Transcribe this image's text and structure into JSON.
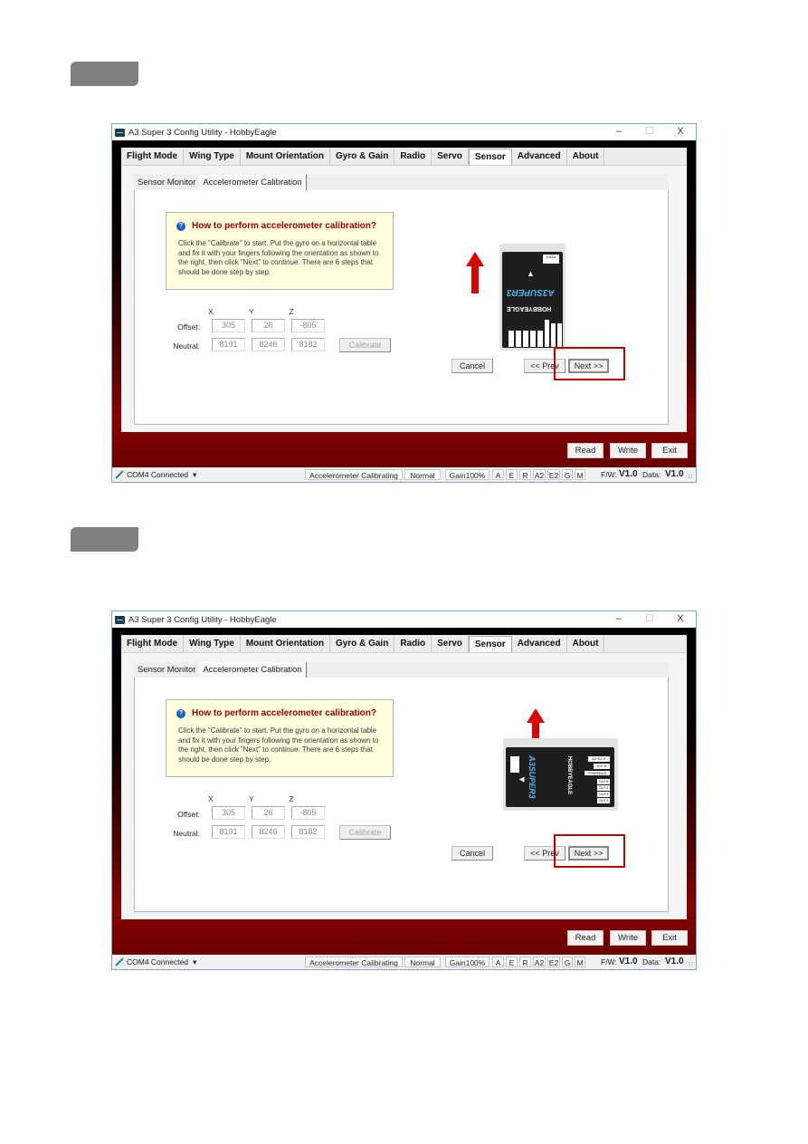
{
  "window": {
    "title": "A3 Super 3 Config Utility - HobbyEagle",
    "controls": {
      "minimize": "–",
      "maximize": "☐",
      "close": "X"
    }
  },
  "tabs": [
    {
      "label": "Flight Mode",
      "active": false
    },
    {
      "label": "Wing Type",
      "active": false
    },
    {
      "label": "Mount Orientation",
      "active": false
    },
    {
      "label": "Gyro & Gain",
      "active": false
    },
    {
      "label": "Radio",
      "active": false
    },
    {
      "label": "Servo",
      "active": false
    },
    {
      "label": "Sensor",
      "active": true
    },
    {
      "label": "Advanced",
      "active": false
    },
    {
      "label": "About",
      "active": false
    }
  ],
  "subtabs": [
    {
      "label": "Sensor Monitor",
      "active": false
    },
    {
      "label": "Accelerometer Calibration",
      "active": true
    }
  ],
  "info": {
    "icon": "help-icon",
    "title": "How to perform accelerometer calibration?",
    "text": "Click the \"Calibrate\" to start. Put the gyro on a horizontal table and fix it with your fingers following the orientation as shown to the right, then click \"Next\" to continue. There are 6 steps that should be done step by step."
  },
  "calibration": {
    "axes": [
      "X",
      "Y",
      "Z"
    ],
    "offset_label": "Offset:",
    "neutral_label": "Neutral:",
    "offset": [
      "305",
      "26",
      "-805"
    ],
    "neutral": [
      "8191",
      "8246",
      "8182"
    ],
    "calibrate_label": "Calibrate"
  },
  "nav": {
    "cancel_label": "Cancel",
    "prev_label": "<< Prev",
    "next_label": "Next >>"
  },
  "device": {
    "brand": "HOBBYEAGLE",
    "model": "A3SUPER3",
    "data_port": "DATA",
    "pins": [
      "A2·E2·G",
      "A·E·R",
      "PPM/SBUS",
      "OUT5",
      "OUT4",
      "OUT3",
      "OUT2",
      "OUT1",
      "⎍ + −"
    ],
    "arrow_color": "#d90000"
  },
  "actions": {
    "read_label": "Read",
    "write_label": "Write",
    "exit_label": "Exit"
  },
  "status": {
    "connection": "COM4 Connected",
    "connection_dropdown": "▾",
    "state": "Accelerometer Calibrating ...",
    "mode": "Normal",
    "gain": "Gain100%",
    "channels": [
      "A",
      "E",
      "R",
      "A2",
      "E2",
      "G",
      "M"
    ],
    "fw_label": "F/W:",
    "fw_value": "V1.0",
    "data_label": "Data:",
    "data_value": "V1.0"
  },
  "steps": [
    {
      "orientation": "vertical"
    },
    {
      "orientation": "horizontal"
    }
  ],
  "colors": {
    "accent_red": "#c00000",
    "title_red": "#a00000",
    "info_bg": "#ffffe0",
    "step_badge": "#7f7f7f"
  }
}
